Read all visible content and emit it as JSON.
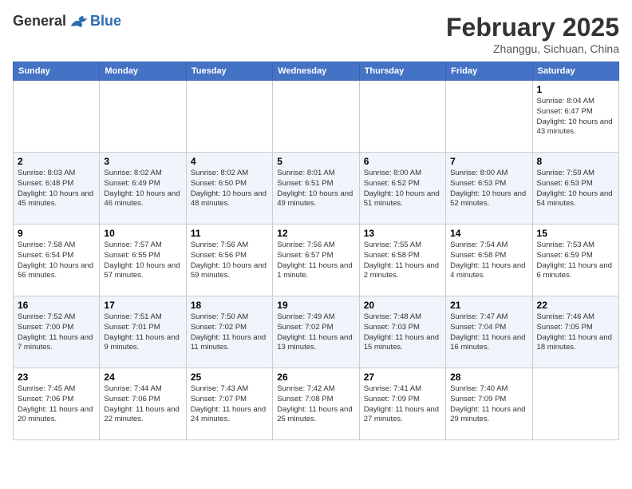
{
  "header": {
    "logo_general": "General",
    "logo_blue": "Blue",
    "month_title": "February 2025",
    "subtitle": "Zhanggu, Sichuan, China"
  },
  "weekdays": [
    "Sunday",
    "Monday",
    "Tuesday",
    "Wednesday",
    "Thursday",
    "Friday",
    "Saturday"
  ],
  "weeks": [
    [
      {
        "day": "",
        "info": ""
      },
      {
        "day": "",
        "info": ""
      },
      {
        "day": "",
        "info": ""
      },
      {
        "day": "",
        "info": ""
      },
      {
        "day": "",
        "info": ""
      },
      {
        "day": "",
        "info": ""
      },
      {
        "day": "1",
        "info": "Sunrise: 8:04 AM\nSunset: 6:47 PM\nDaylight: 10 hours and 43 minutes."
      }
    ],
    [
      {
        "day": "2",
        "info": "Sunrise: 8:03 AM\nSunset: 6:48 PM\nDaylight: 10 hours and 45 minutes."
      },
      {
        "day": "3",
        "info": "Sunrise: 8:02 AM\nSunset: 6:49 PM\nDaylight: 10 hours and 46 minutes."
      },
      {
        "day": "4",
        "info": "Sunrise: 8:02 AM\nSunset: 6:50 PM\nDaylight: 10 hours and 48 minutes."
      },
      {
        "day": "5",
        "info": "Sunrise: 8:01 AM\nSunset: 6:51 PM\nDaylight: 10 hours and 49 minutes."
      },
      {
        "day": "6",
        "info": "Sunrise: 8:00 AM\nSunset: 6:52 PM\nDaylight: 10 hours and 51 minutes."
      },
      {
        "day": "7",
        "info": "Sunrise: 8:00 AM\nSunset: 6:53 PM\nDaylight: 10 hours and 52 minutes."
      },
      {
        "day": "8",
        "info": "Sunrise: 7:59 AM\nSunset: 6:53 PM\nDaylight: 10 hours and 54 minutes."
      }
    ],
    [
      {
        "day": "9",
        "info": "Sunrise: 7:58 AM\nSunset: 6:54 PM\nDaylight: 10 hours and 56 minutes."
      },
      {
        "day": "10",
        "info": "Sunrise: 7:57 AM\nSunset: 6:55 PM\nDaylight: 10 hours and 57 minutes."
      },
      {
        "day": "11",
        "info": "Sunrise: 7:56 AM\nSunset: 6:56 PM\nDaylight: 10 hours and 59 minutes."
      },
      {
        "day": "12",
        "info": "Sunrise: 7:56 AM\nSunset: 6:57 PM\nDaylight: 11 hours and 1 minute."
      },
      {
        "day": "13",
        "info": "Sunrise: 7:55 AM\nSunset: 6:58 PM\nDaylight: 11 hours and 2 minutes."
      },
      {
        "day": "14",
        "info": "Sunrise: 7:54 AM\nSunset: 6:58 PM\nDaylight: 11 hours and 4 minutes."
      },
      {
        "day": "15",
        "info": "Sunrise: 7:53 AM\nSunset: 6:59 PM\nDaylight: 11 hours and 6 minutes."
      }
    ],
    [
      {
        "day": "16",
        "info": "Sunrise: 7:52 AM\nSunset: 7:00 PM\nDaylight: 11 hours and 7 minutes."
      },
      {
        "day": "17",
        "info": "Sunrise: 7:51 AM\nSunset: 7:01 PM\nDaylight: 11 hours and 9 minutes."
      },
      {
        "day": "18",
        "info": "Sunrise: 7:50 AM\nSunset: 7:02 PM\nDaylight: 11 hours and 11 minutes."
      },
      {
        "day": "19",
        "info": "Sunrise: 7:49 AM\nSunset: 7:02 PM\nDaylight: 11 hours and 13 minutes."
      },
      {
        "day": "20",
        "info": "Sunrise: 7:48 AM\nSunset: 7:03 PM\nDaylight: 11 hours and 15 minutes."
      },
      {
        "day": "21",
        "info": "Sunrise: 7:47 AM\nSunset: 7:04 PM\nDaylight: 11 hours and 16 minutes."
      },
      {
        "day": "22",
        "info": "Sunrise: 7:46 AM\nSunset: 7:05 PM\nDaylight: 11 hours and 18 minutes."
      }
    ],
    [
      {
        "day": "23",
        "info": "Sunrise: 7:45 AM\nSunset: 7:06 PM\nDaylight: 11 hours and 20 minutes."
      },
      {
        "day": "24",
        "info": "Sunrise: 7:44 AM\nSunset: 7:06 PM\nDaylight: 11 hours and 22 minutes."
      },
      {
        "day": "25",
        "info": "Sunrise: 7:43 AM\nSunset: 7:07 PM\nDaylight: 11 hours and 24 minutes."
      },
      {
        "day": "26",
        "info": "Sunrise: 7:42 AM\nSunset: 7:08 PM\nDaylight: 11 hours and 25 minutes."
      },
      {
        "day": "27",
        "info": "Sunrise: 7:41 AM\nSunset: 7:09 PM\nDaylight: 11 hours and 27 minutes."
      },
      {
        "day": "28",
        "info": "Sunrise: 7:40 AM\nSunset: 7:09 PM\nDaylight: 11 hours and 29 minutes."
      },
      {
        "day": "",
        "info": ""
      }
    ]
  ]
}
